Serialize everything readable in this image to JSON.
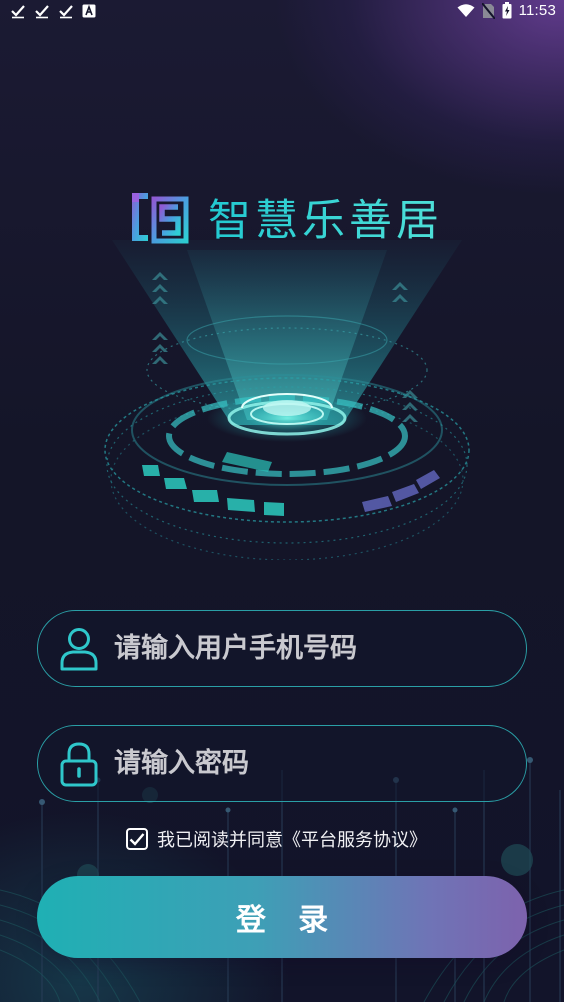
{
  "status_bar": {
    "time": "11:53",
    "left_icons": [
      "check-icon",
      "check-icon",
      "check-icon",
      "text-a-icon"
    ],
    "right_icons": [
      "wifi-icon",
      "sim-off-icon",
      "battery-charging-icon"
    ]
  },
  "app": {
    "title": "智慧乐善居",
    "logo_icon": "logo-s-icon"
  },
  "login_form": {
    "phone": {
      "value": "",
      "placeholder": "请输入用户手机号码",
      "icon": "user-icon"
    },
    "password": {
      "value": "",
      "placeholder": "请输入密码",
      "icon": "lock-icon"
    },
    "agreement": {
      "checked": true,
      "text": "我已阅读并同意《平台服务协议》"
    },
    "login_label": "登 录"
  },
  "colors": {
    "background": "#13142a",
    "accent_cyan": "#2bd3d6",
    "field_border": "#2a9fa6",
    "button_start": "#1fb0b4",
    "button_end": "#7d62ad"
  }
}
